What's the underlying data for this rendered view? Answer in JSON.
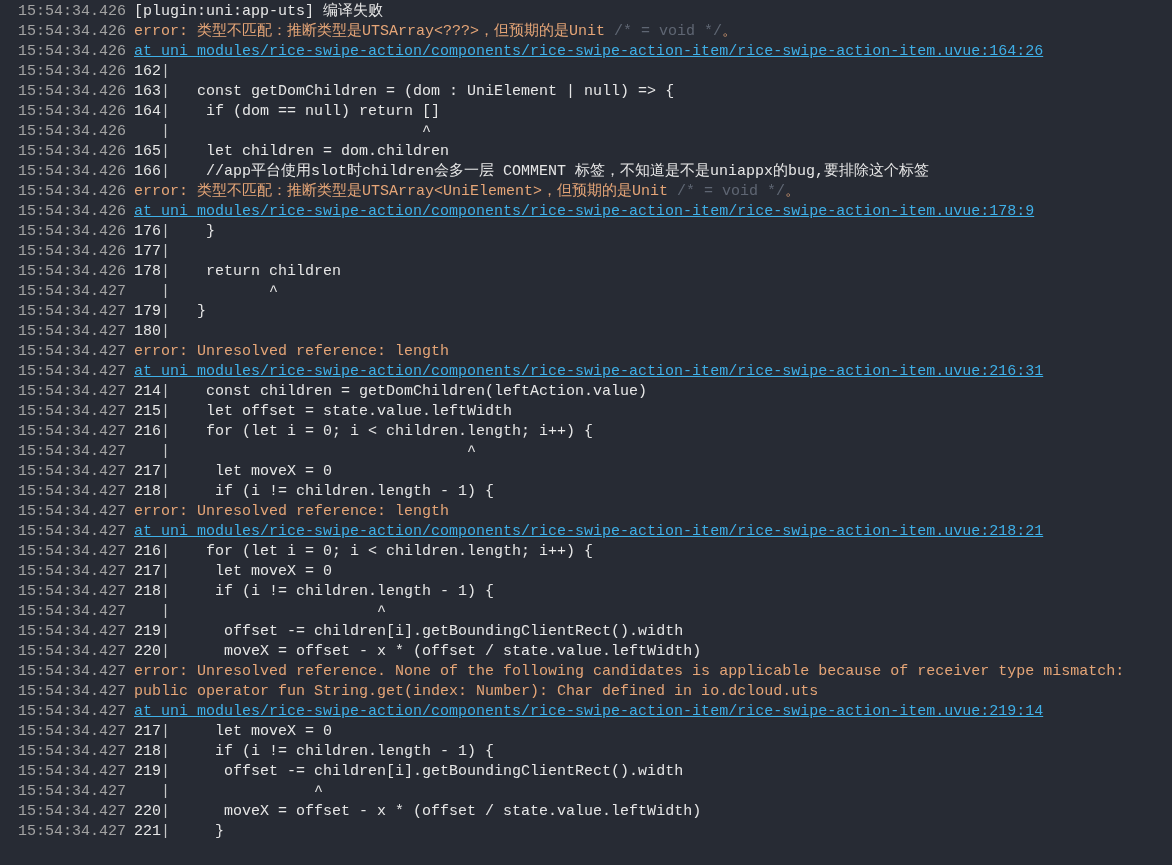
{
  "lines": [
    {
      "time": "15:54:34.426",
      "kind": "plain",
      "text": "[plugin:uni:app-uts] 编译失败"
    },
    {
      "time": "15:54:34.426",
      "kind": "error",
      "segments": [
        {
          "kind": "message",
          "text": "error: 类型不匹配：推断类型是UTSArray<???>，但预期的是Unit"
        },
        {
          "kind": "comment",
          "text": " /* = void */"
        },
        {
          "kind": "message",
          "text": "。"
        }
      ]
    },
    {
      "time": "15:54:34.426",
      "kind": "link",
      "text": "at uni_modules/rice-swipe-action/components/rice-swipe-action-item/rice-swipe-action-item.uvue:164:26"
    },
    {
      "time": "15:54:34.426",
      "kind": "source",
      "number": "162",
      "bar": "|"
    },
    {
      "time": "15:54:34.426",
      "kind": "source",
      "number": "163",
      "bar": "|",
      "code": "   const getDomChildren = (dom : UniElement | null) => {"
    },
    {
      "time": "15:54:34.426",
      "kind": "source",
      "number": "164",
      "bar": "|",
      "code": "    if (dom == null) return []"
    },
    {
      "time": "15:54:34.426",
      "kind": "source",
      "bar": "|",
      "code": "                            ^"
    },
    {
      "time": "15:54:34.426",
      "kind": "source",
      "number": "165",
      "bar": "|",
      "code": "    let children = dom.children"
    },
    {
      "time": "15:54:34.426",
      "kind": "source",
      "number": "166",
      "bar": "|",
      "code": "    //app平台使用slot时children会多一层 COMMENT 标签，不知道是不是uniappx的bug,要排除这个标签"
    },
    {
      "time": "15:54:34.426",
      "kind": "error",
      "segments": [
        {
          "kind": "message",
          "text": "error: 类型不匹配：推断类型是UTSArray<UniElement>，但预期的是Unit"
        },
        {
          "kind": "comment",
          "text": " /* = void */"
        },
        {
          "kind": "message",
          "text": "。"
        }
      ]
    },
    {
      "time": "15:54:34.426",
      "kind": "link",
      "text": "at uni_modules/rice-swipe-action/components/rice-swipe-action-item/rice-swipe-action-item.uvue:178:9"
    },
    {
      "time": "15:54:34.426",
      "kind": "source",
      "number": "176",
      "bar": "|",
      "code": "    }"
    },
    {
      "time": "15:54:34.426",
      "kind": "source",
      "number": "177",
      "bar": "|"
    },
    {
      "time": "15:54:34.426",
      "kind": "source",
      "number": "178",
      "bar": "|",
      "code": "    return children"
    },
    {
      "time": "15:54:34.427",
      "kind": "source",
      "bar": "|",
      "code": "           ^"
    },
    {
      "time": "15:54:34.427",
      "kind": "source",
      "number": "179",
      "bar": "|",
      "code": "   }"
    },
    {
      "time": "15:54:34.427",
      "kind": "source",
      "number": "180",
      "bar": "|"
    },
    {
      "time": "15:54:34.427",
      "kind": "error",
      "segments": [
        {
          "kind": "message",
          "text": "error: Unresolved reference: length"
        }
      ]
    },
    {
      "time": "15:54:34.427",
      "kind": "link",
      "text": "at uni_modules/rice-swipe-action/components/rice-swipe-action-item/rice-swipe-action-item.uvue:216:31"
    },
    {
      "time": "15:54:34.427",
      "kind": "source",
      "number": "214",
      "bar": "|",
      "code": "    const children = getDomChildren(leftAction.value)"
    },
    {
      "time": "15:54:34.427",
      "kind": "source",
      "number": "215",
      "bar": "|",
      "code": "    let offset = state.value.leftWidth"
    },
    {
      "time": "15:54:34.427",
      "kind": "source",
      "number": "216",
      "bar": "|",
      "code": "    for (let i = 0; i < children.length; i++) {"
    },
    {
      "time": "15:54:34.427",
      "kind": "source",
      "bar": "|",
      "code": "                                 ^"
    },
    {
      "time": "15:54:34.427",
      "kind": "source",
      "number": "217",
      "bar": "|",
      "code": "     let moveX = 0"
    },
    {
      "time": "15:54:34.427",
      "kind": "source",
      "number": "218",
      "bar": "|",
      "code": "     if (i != children.length - 1) {"
    },
    {
      "time": "15:54:34.427",
      "kind": "error",
      "segments": [
        {
          "kind": "message",
          "text": "error: Unresolved reference: length"
        }
      ]
    },
    {
      "time": "15:54:34.427",
      "kind": "link",
      "text": "at uni_modules/rice-swipe-action/components/rice-swipe-action-item/rice-swipe-action-item.uvue:218:21"
    },
    {
      "time": "15:54:34.427",
      "kind": "source",
      "number": "216",
      "bar": "|",
      "code": "    for (let i = 0; i < children.length; i++) {"
    },
    {
      "time": "15:54:34.427",
      "kind": "source",
      "number": "217",
      "bar": "|",
      "code": "     let moveX = 0"
    },
    {
      "time": "15:54:34.427",
      "kind": "source",
      "number": "218",
      "bar": "|",
      "code": "     if (i != children.length - 1) {"
    },
    {
      "time": "15:54:34.427",
      "kind": "source",
      "bar": "|",
      "code": "                       ^"
    },
    {
      "time": "15:54:34.427",
      "kind": "source",
      "number": "219",
      "bar": "|",
      "code": "      offset -= children[i].getBoundingClientRect().width"
    },
    {
      "time": "15:54:34.427",
      "kind": "source",
      "number": "220",
      "bar": "|",
      "code": "      moveX = offset - x * (offset / state.value.leftWidth)"
    },
    {
      "time": "15:54:34.427",
      "kind": "error",
      "segments": [
        {
          "kind": "message",
          "text": "error: Unresolved reference. None of the following candidates is applicable because of receiver type mismatch:"
        }
      ]
    },
    {
      "time": "15:54:34.427",
      "kind": "error",
      "segments": [
        {
          "kind": "message",
          "text": "public operator fun String.get(index: Number): Char defined in io.dcloud.uts"
        }
      ]
    },
    {
      "time": "15:54:34.427",
      "kind": "link",
      "text": "at uni_modules/rice-swipe-action/components/rice-swipe-action-item/rice-swipe-action-item.uvue:219:14"
    },
    {
      "time": "15:54:34.427",
      "kind": "source",
      "number": "217",
      "bar": "|",
      "code": "     let moveX = 0"
    },
    {
      "time": "15:54:34.427",
      "kind": "source",
      "number": "218",
      "bar": "|",
      "code": "     if (i != children.length - 1) {"
    },
    {
      "time": "15:54:34.427",
      "kind": "source",
      "number": "219",
      "bar": "|",
      "code": "      offset -= children[i].getBoundingClientRect().width"
    },
    {
      "time": "15:54:34.427",
      "kind": "source",
      "bar": "|",
      "code": "                ^"
    },
    {
      "time": "15:54:34.427",
      "kind": "source",
      "number": "220",
      "bar": "|",
      "code": "      moveX = offset - x * (offset / state.value.leftWidth)"
    },
    {
      "time": "15:54:34.427",
      "kind": "source",
      "number": "221",
      "bar": "|",
      "code": "     }"
    }
  ]
}
